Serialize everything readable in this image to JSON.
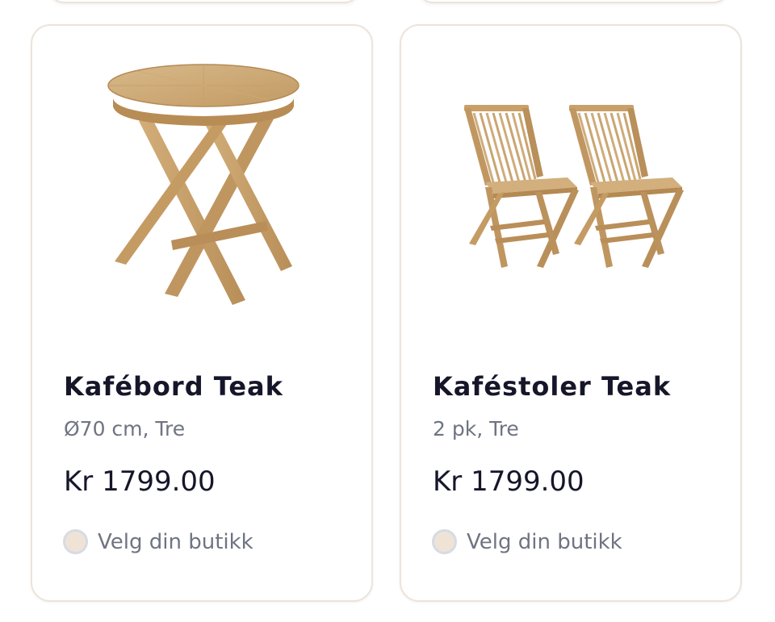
{
  "products": [
    {
      "title": "Kafébord Teak",
      "subtitle": "Ø70 cm, Tre",
      "price": "Kr 1799.00",
      "store_label": "Velg din butikk",
      "image": "round-folding-teak-table"
    },
    {
      "title": "Kaféstoler Teak",
      "subtitle": "2 pk, Tre",
      "price": "Kr 1799.00",
      "store_label": "Velg din butikk",
      "image": "two-folding-teak-chairs"
    }
  ],
  "colors": {
    "title": "#16162a",
    "muted": "#6f7482",
    "card_border": "#ede4da",
    "radio_fill": "#efe3d6",
    "radio_border": "#d6dbe4",
    "wood": "#c9a472"
  }
}
